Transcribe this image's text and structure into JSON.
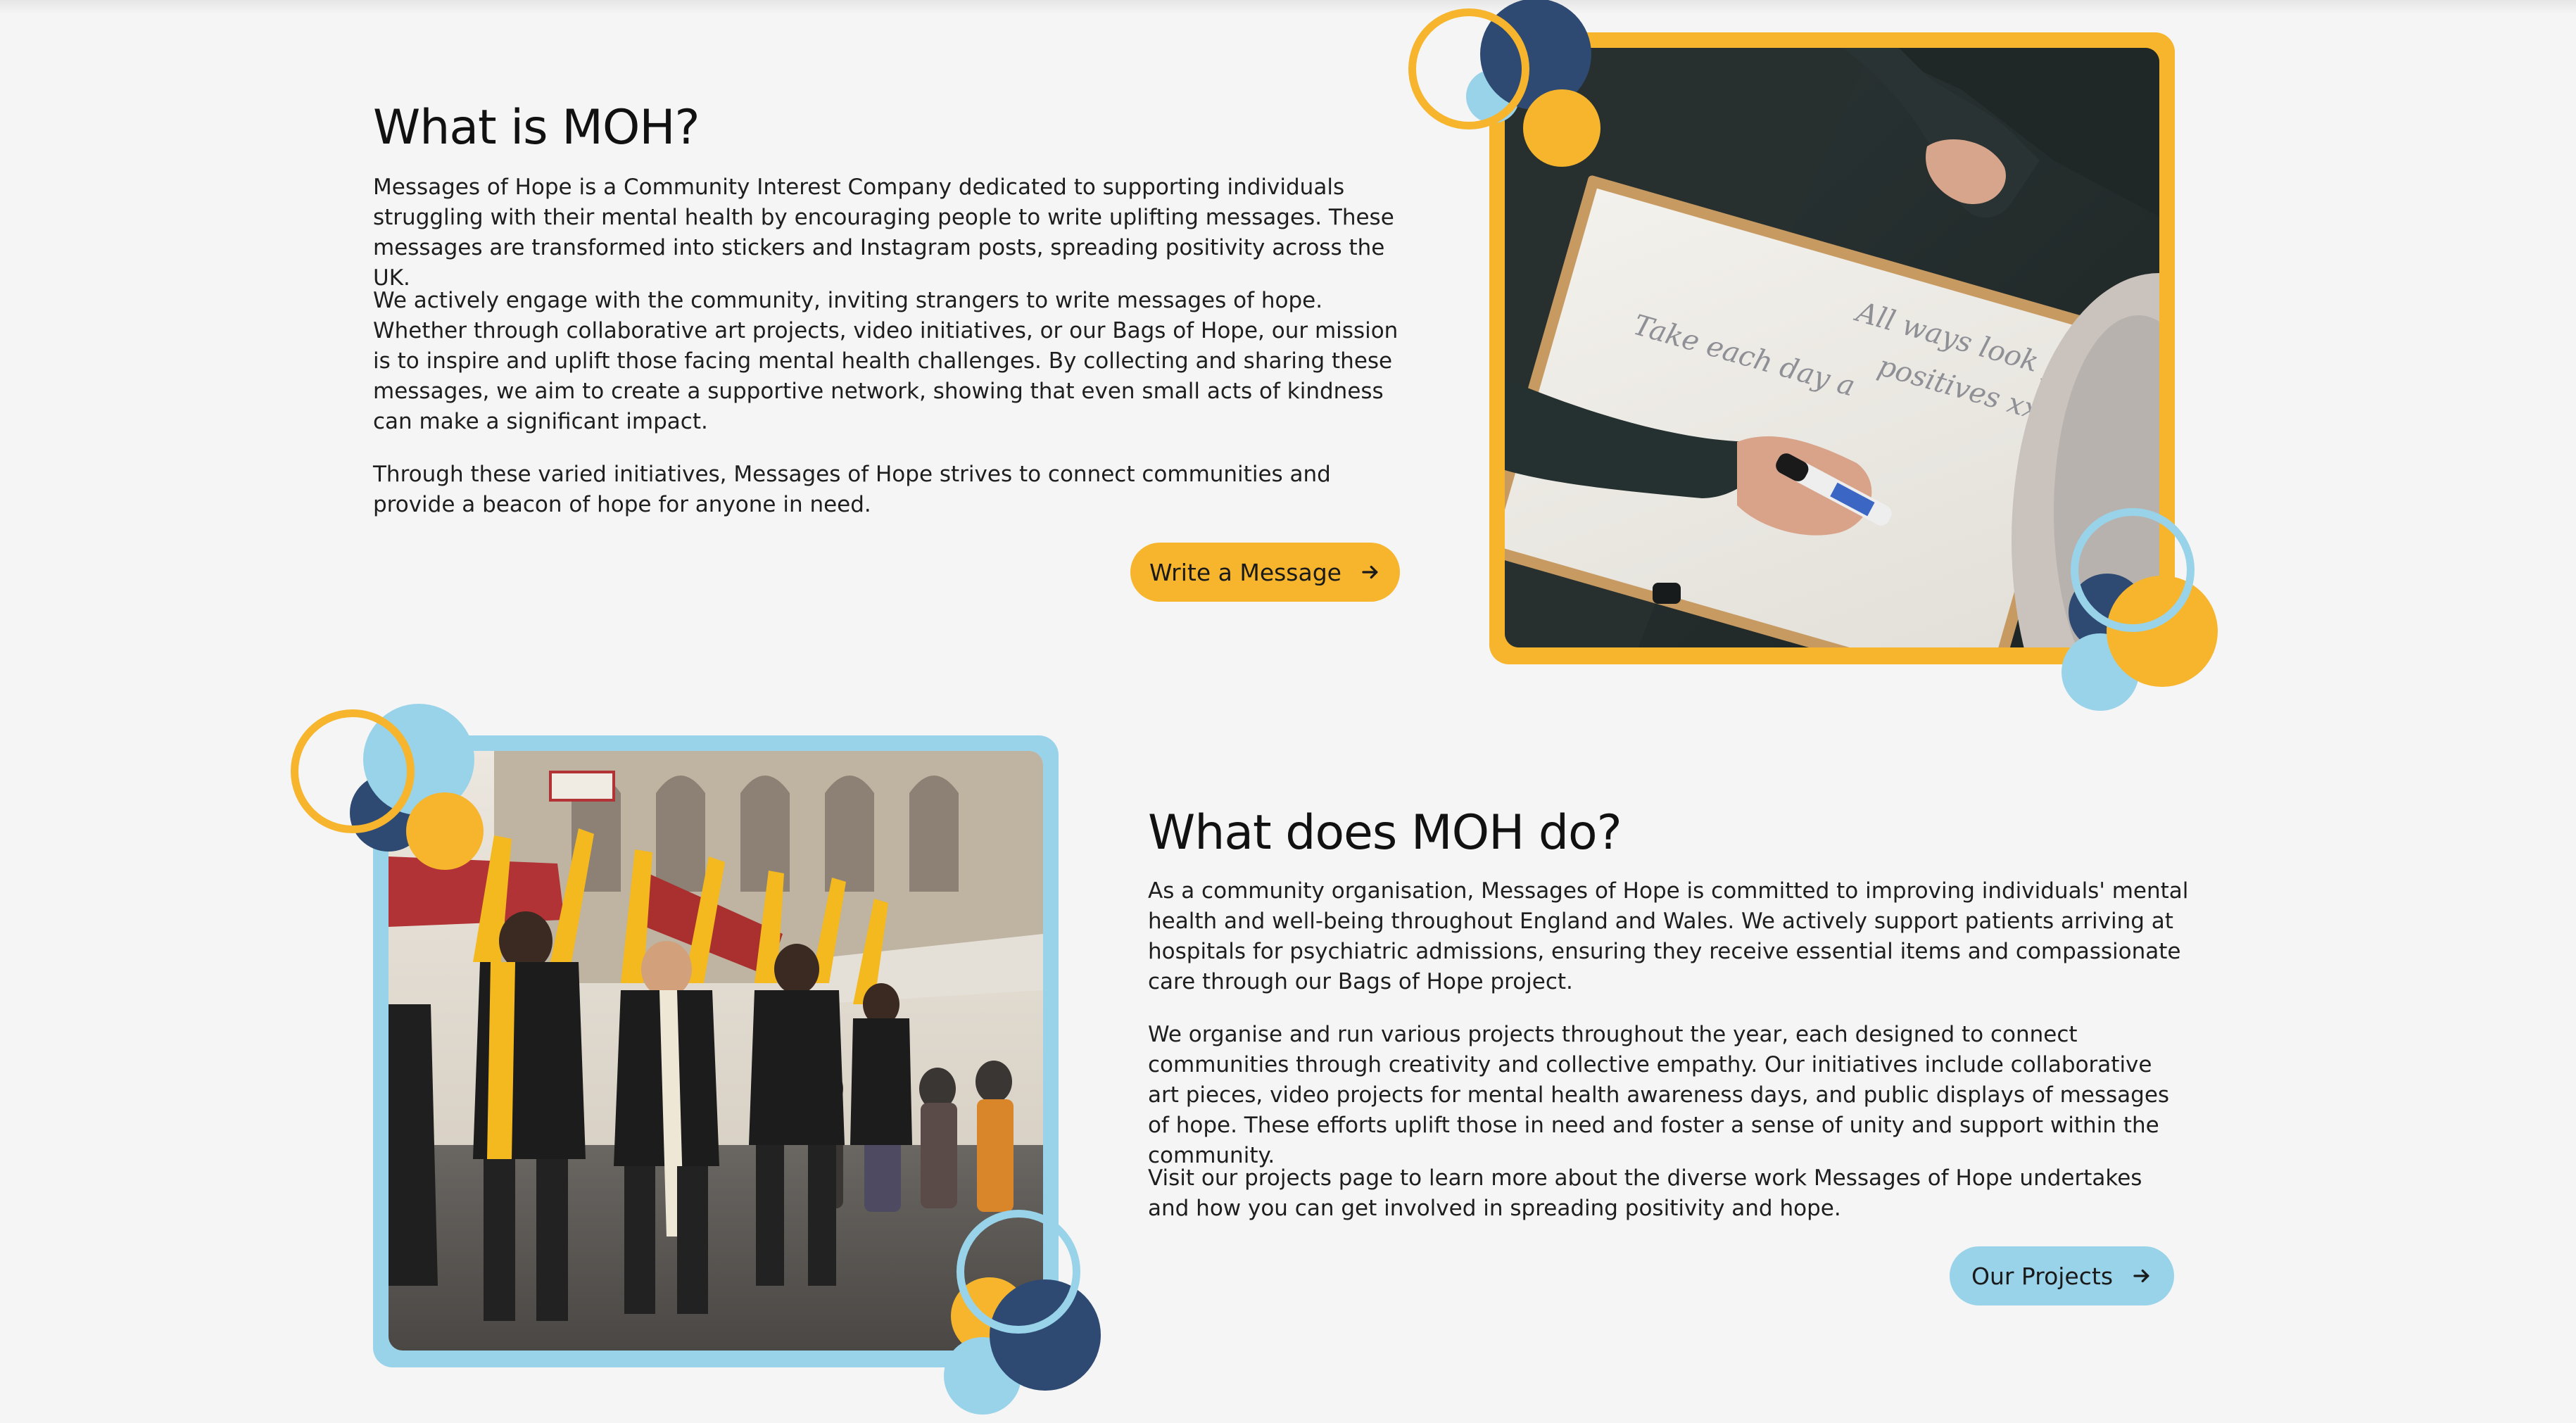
{
  "about": {
    "heading": "What is MOH?",
    "paragraphs": [
      "Messages of Hope is a Community Interest Company dedicated to supporting individuals struggling with their mental health by encouraging people to write uplifting messages. These messages are transformed into stickers and Instagram posts, spreading positivity across the UK.",
      "We actively engage with the community, inviting strangers to write messages of hope. Whether through collaborative art projects, video initiatives, or our Bags of Hope, our mission is to inspire and uplift those facing mental health challenges. By collecting and sharing these messages, we aim to create a supportive network, showing that even small acts of kindness can make a significant impact.",
      "Through these varied initiatives, Messages of Hope strives to connect communities and provide a beacon of hope for anyone in need."
    ],
    "button_label": "Write a Message",
    "whiteboard_text": [
      "All ways look for",
      "positives xx",
      "Take each day a"
    ]
  },
  "work": {
    "heading": "What does MOH do?",
    "paragraphs": [
      "As a community organisation, Messages of Hope is committed to improving individuals' mental health and well-being throughout England and Wales. We actively support patients arriving at hospitals for psychiatric admissions, ensuring they receive essential items and compassionate care through our Bags of Hope project.",
      "We organise and run various projects throughout the year, each designed to connect communities through creativity and collective empathy. Our initiatives include collaborative art pieces, video projects for mental health awareness days, and public displays of messages of hope. These efforts uplift those in need and foster a sense of unity and support within the community.",
      "Visit our projects page to learn more about the diverse work Messages of Hope undertakes and how you can get involved in spreading positivity and hope."
    ],
    "button_label": "Our Projects"
  },
  "icons": {
    "button_arrow": "arrow-right-icon"
  },
  "colors": {
    "yellow": "#f6b52c",
    "light_blue": "#98d3ea",
    "navy": "#2e4a73",
    "background": "#f5f5f5"
  }
}
